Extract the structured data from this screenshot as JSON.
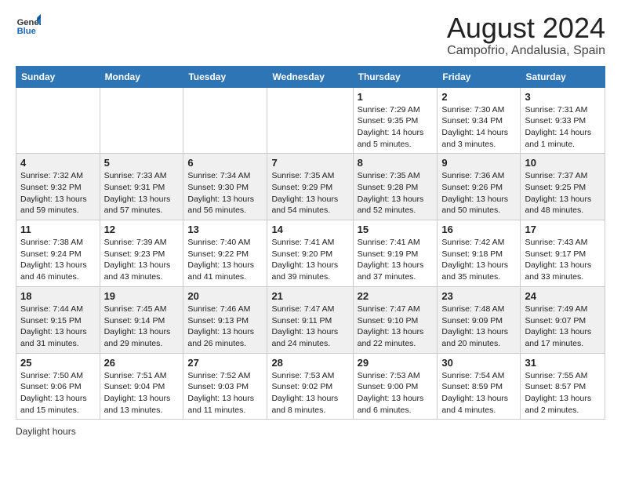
{
  "logo": {
    "text_general": "General",
    "text_blue": "Blue"
  },
  "title": "August 2024",
  "subtitle": "Campofrio, Andalusia, Spain",
  "days_of_week": [
    "Sunday",
    "Monday",
    "Tuesday",
    "Wednesday",
    "Thursday",
    "Friday",
    "Saturday"
  ],
  "legend": "Daylight hours",
  "weeks": [
    [
      {
        "day": "",
        "info": ""
      },
      {
        "day": "",
        "info": ""
      },
      {
        "day": "",
        "info": ""
      },
      {
        "day": "",
        "info": ""
      },
      {
        "day": "1",
        "info": "Sunrise: 7:29 AM\nSunset: 9:35 PM\nDaylight: 14 hours\nand 5 minutes."
      },
      {
        "day": "2",
        "info": "Sunrise: 7:30 AM\nSunset: 9:34 PM\nDaylight: 14 hours\nand 3 minutes."
      },
      {
        "day": "3",
        "info": "Sunrise: 7:31 AM\nSunset: 9:33 PM\nDaylight: 14 hours\nand 1 minute."
      }
    ],
    [
      {
        "day": "4",
        "info": "Sunrise: 7:32 AM\nSunset: 9:32 PM\nDaylight: 13 hours\nand 59 minutes."
      },
      {
        "day": "5",
        "info": "Sunrise: 7:33 AM\nSunset: 9:31 PM\nDaylight: 13 hours\nand 57 minutes."
      },
      {
        "day": "6",
        "info": "Sunrise: 7:34 AM\nSunset: 9:30 PM\nDaylight: 13 hours\nand 56 minutes."
      },
      {
        "day": "7",
        "info": "Sunrise: 7:35 AM\nSunset: 9:29 PM\nDaylight: 13 hours\nand 54 minutes."
      },
      {
        "day": "8",
        "info": "Sunrise: 7:35 AM\nSunset: 9:28 PM\nDaylight: 13 hours\nand 52 minutes."
      },
      {
        "day": "9",
        "info": "Sunrise: 7:36 AM\nSunset: 9:26 PM\nDaylight: 13 hours\nand 50 minutes."
      },
      {
        "day": "10",
        "info": "Sunrise: 7:37 AM\nSunset: 9:25 PM\nDaylight: 13 hours\nand 48 minutes."
      }
    ],
    [
      {
        "day": "11",
        "info": "Sunrise: 7:38 AM\nSunset: 9:24 PM\nDaylight: 13 hours\nand 46 minutes."
      },
      {
        "day": "12",
        "info": "Sunrise: 7:39 AM\nSunset: 9:23 PM\nDaylight: 13 hours\nand 43 minutes."
      },
      {
        "day": "13",
        "info": "Sunrise: 7:40 AM\nSunset: 9:22 PM\nDaylight: 13 hours\nand 41 minutes."
      },
      {
        "day": "14",
        "info": "Sunrise: 7:41 AM\nSunset: 9:20 PM\nDaylight: 13 hours\nand 39 minutes."
      },
      {
        "day": "15",
        "info": "Sunrise: 7:41 AM\nSunset: 9:19 PM\nDaylight: 13 hours\nand 37 minutes."
      },
      {
        "day": "16",
        "info": "Sunrise: 7:42 AM\nSunset: 9:18 PM\nDaylight: 13 hours\nand 35 minutes."
      },
      {
        "day": "17",
        "info": "Sunrise: 7:43 AM\nSunset: 9:17 PM\nDaylight: 13 hours\nand 33 minutes."
      }
    ],
    [
      {
        "day": "18",
        "info": "Sunrise: 7:44 AM\nSunset: 9:15 PM\nDaylight: 13 hours\nand 31 minutes."
      },
      {
        "day": "19",
        "info": "Sunrise: 7:45 AM\nSunset: 9:14 PM\nDaylight: 13 hours\nand 29 minutes."
      },
      {
        "day": "20",
        "info": "Sunrise: 7:46 AM\nSunset: 9:13 PM\nDaylight: 13 hours\nand 26 minutes."
      },
      {
        "day": "21",
        "info": "Sunrise: 7:47 AM\nSunset: 9:11 PM\nDaylight: 13 hours\nand 24 minutes."
      },
      {
        "day": "22",
        "info": "Sunrise: 7:47 AM\nSunset: 9:10 PM\nDaylight: 13 hours\nand 22 minutes."
      },
      {
        "day": "23",
        "info": "Sunrise: 7:48 AM\nSunset: 9:09 PM\nDaylight: 13 hours\nand 20 minutes."
      },
      {
        "day": "24",
        "info": "Sunrise: 7:49 AM\nSunset: 9:07 PM\nDaylight: 13 hours\nand 17 minutes."
      }
    ],
    [
      {
        "day": "25",
        "info": "Sunrise: 7:50 AM\nSunset: 9:06 PM\nDaylight: 13 hours\nand 15 minutes."
      },
      {
        "day": "26",
        "info": "Sunrise: 7:51 AM\nSunset: 9:04 PM\nDaylight: 13 hours\nand 13 minutes."
      },
      {
        "day": "27",
        "info": "Sunrise: 7:52 AM\nSunset: 9:03 PM\nDaylight: 13 hours\nand 11 minutes."
      },
      {
        "day": "28",
        "info": "Sunrise: 7:53 AM\nSunset: 9:02 PM\nDaylight: 13 hours\nand 8 minutes."
      },
      {
        "day": "29",
        "info": "Sunrise: 7:53 AM\nSunset: 9:00 PM\nDaylight: 13 hours\nand 6 minutes."
      },
      {
        "day": "30",
        "info": "Sunrise: 7:54 AM\nSunset: 8:59 PM\nDaylight: 13 hours\nand 4 minutes."
      },
      {
        "day": "31",
        "info": "Sunrise: 7:55 AM\nSunset: 8:57 PM\nDaylight: 13 hours\nand 2 minutes."
      }
    ]
  ]
}
